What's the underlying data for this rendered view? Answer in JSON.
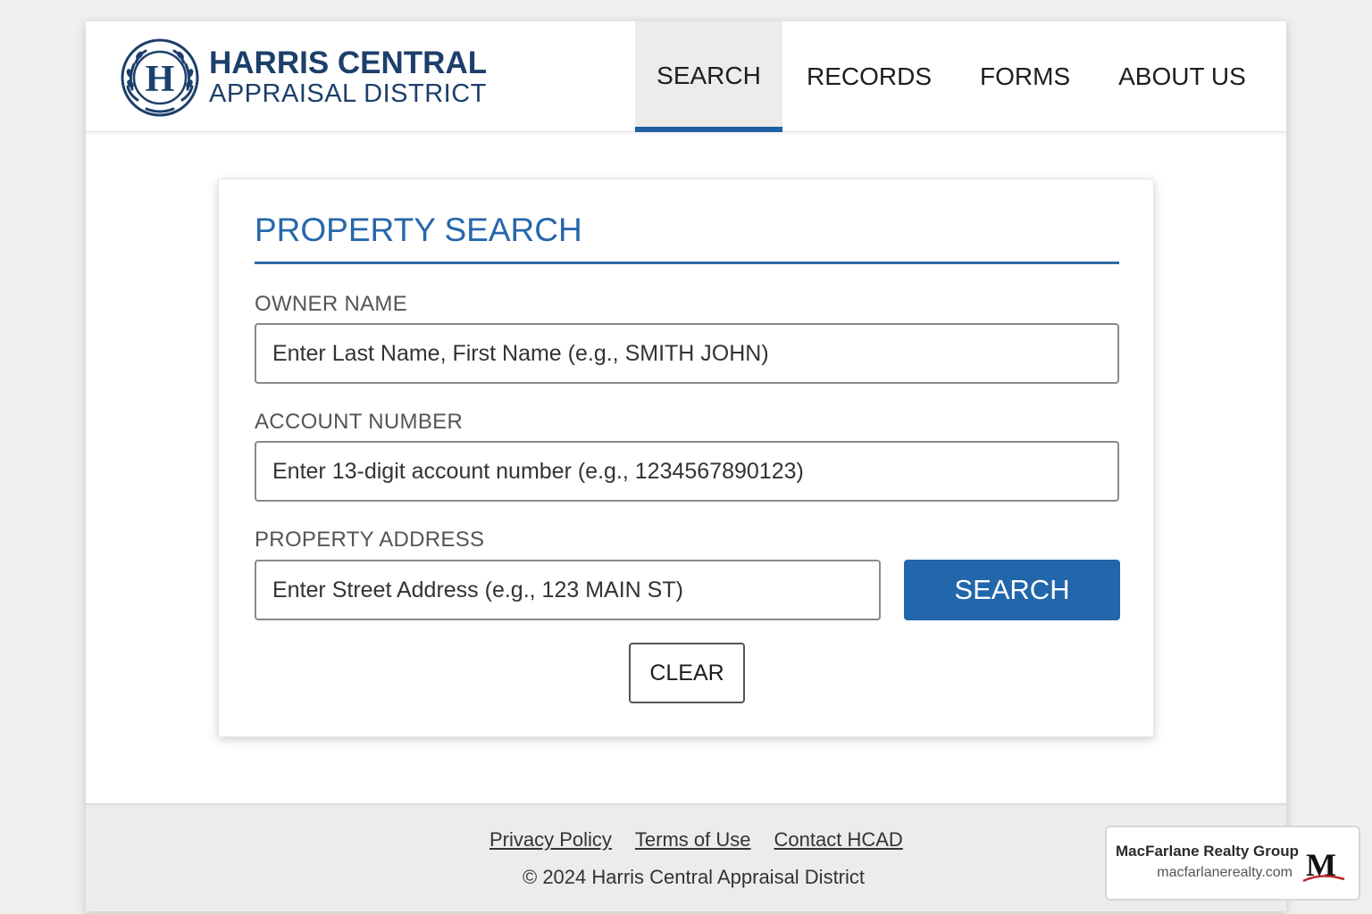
{
  "header": {
    "logo_line1": "HARRIS CENTRAL",
    "logo_line2": "APPRAISAL DISTRICT",
    "seal_letter": "H",
    "nav": [
      {
        "label": "SEARCH",
        "active": true
      },
      {
        "label": "RECORDS",
        "active": false
      },
      {
        "label": "FORMS",
        "active": false
      },
      {
        "label": "ABOUT US",
        "active": false
      }
    ]
  },
  "search_form": {
    "title": "PROPERTY SEARCH",
    "owner_label": "OWNER NAME",
    "owner_placeholder": "Enter Last Name, First Name (e.g., SMITH JOHN)",
    "account_label": "ACCOUNT NUMBER",
    "account_placeholder": "Enter 13-digit account number (e.g., 1234567890123)",
    "address_label": "PROPERTY ADDRESS",
    "address_placeholder": "Enter Street Address (e.g., 123 MAIN ST)",
    "search_button": "SEARCH",
    "clear_button": "CLEAR"
  },
  "footer": {
    "links": [
      "Privacy Policy",
      "Terms of Use",
      "Contact HCAD"
    ],
    "copyright": "© 2024 Harris Central Appraisal District"
  },
  "watermark": {
    "name": "MacFarlane Realty Group",
    "url": "macfarlanerealty.com",
    "logo_letter": "M"
  },
  "colors": {
    "brand_navy": "#1d3f6b",
    "accent_blue": "#2266ab",
    "footer_bg": "#ececea"
  }
}
